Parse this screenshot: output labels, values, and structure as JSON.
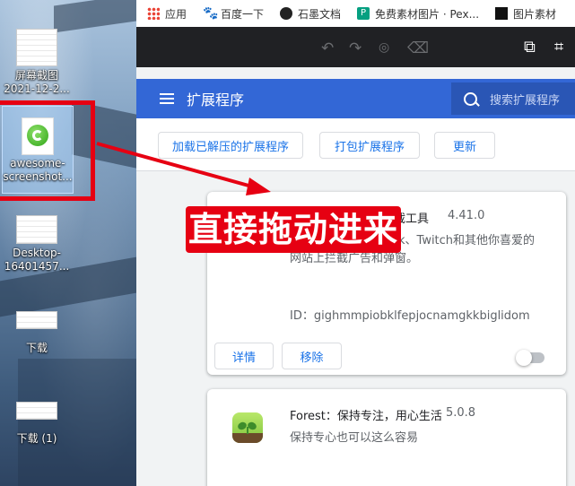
{
  "desktop": {
    "icons": [
      {
        "label": "屏幕截图\n2021-12-2...",
        "line1": "屏幕截图",
        "line2": "2021-12-2..."
      },
      {
        "line1": "awesome-",
        "line2": "screenshot..."
      },
      {
        "line1": "Desktop-",
        "line2": "16401457..."
      },
      {
        "line1": "下载"
      },
      {
        "line1": "下载 (1)"
      }
    ]
  },
  "bookmarks": [
    {
      "label": "应用",
      "icon": "apps-grid-icon"
    },
    {
      "label": "百度一下",
      "icon": "baidu-paw-icon"
    },
    {
      "label": "石墨文档",
      "icon": "shimo-icon"
    },
    {
      "label": "免费素材图片 · Pex...",
      "icon": "pexels-icon"
    },
    {
      "label": "图片素材",
      "icon": "image-material-icon"
    }
  ],
  "header": {
    "title": "扩展程序",
    "search_placeholder": "搜索扩展程序"
  },
  "actions": {
    "load_unpacked": "加载已解压的扩展程序",
    "pack": "打包扩展程序",
    "update": "更新"
  },
  "extensions": [
    {
      "name_partial": "截工具",
      "version": "4.41.0",
      "desc_line1": "k、Twitch和其他你喜爱的",
      "desc_line2": "网站上拦截广告和弹窗。",
      "id": "ID：gighmmpiobklfepjocnamgkkbiglidom",
      "details": "详情",
      "remove": "移除",
      "enabled": false
    },
    {
      "name": "Forest：保持专注，用心生活",
      "version": "5.0.8",
      "desc": "保持专心也可以这么容易",
      "icon": "forest-icon"
    }
  ],
  "annotation": {
    "text": "直接拖动进来",
    "color": "#e60012"
  },
  "colors": {
    "header_blue": "#3367d6",
    "accent": "#1a73e8",
    "dark_toolbar": "#202124"
  }
}
